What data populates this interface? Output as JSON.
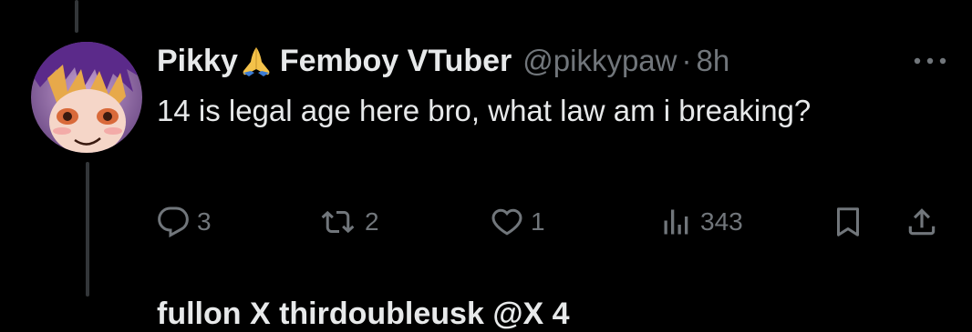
{
  "tweet": {
    "display_name": "Pikky",
    "display_name_suffix": "Femboy VTuber",
    "emoji_icon": "folded-hands-icon",
    "handle": "@pikkypaw",
    "separator": "·",
    "time": "8h",
    "text": "14 is legal age here bro, what law am i breaking?",
    "actions": {
      "replies": "3",
      "retweets": "2",
      "likes": "1",
      "views": "343"
    }
  },
  "next_tweet": {
    "partial_text": "fullon X    thirdoubleusk    @X         4"
  },
  "colors": {
    "background": "#000000",
    "text": "#e7e9ea",
    "secondary": "#71767b",
    "thread_line": "#333639"
  }
}
